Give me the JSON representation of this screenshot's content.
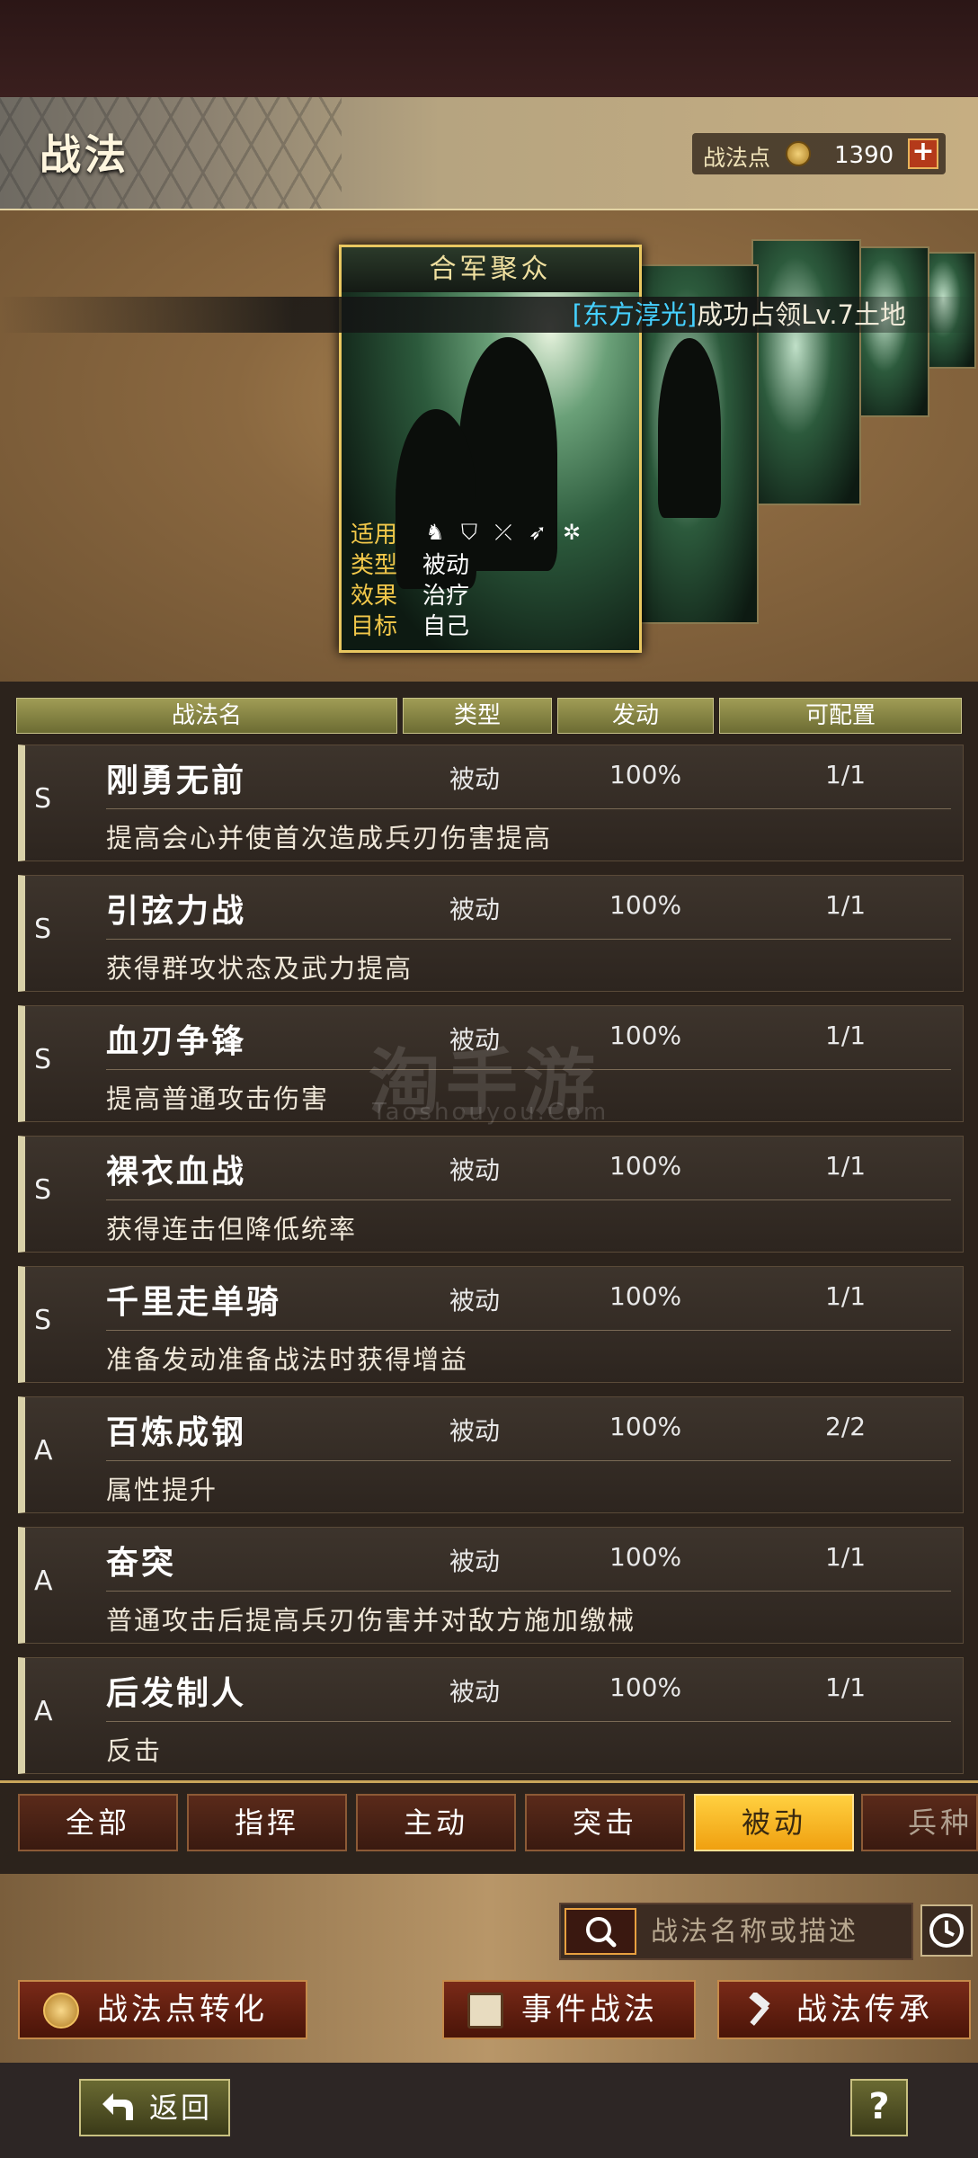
{
  "header": {
    "title": "战法",
    "points_label": "战法点",
    "points_value": "1390",
    "plus": "+"
  },
  "showcase": {
    "card": {
      "title": "合军聚众",
      "info": [
        {
          "key": "适用",
          "value": ""
        },
        {
          "key": "类型",
          "value": "被动"
        },
        {
          "key": "效果",
          "value": "治疗"
        },
        {
          "key": "目标",
          "value": "自己"
        }
      ],
      "troop_icons": [
        "cavalry-icon",
        "shield-icon",
        "bow-icon",
        "spear-icon",
        "chariot-icon"
      ]
    },
    "banner": {
      "highlight": "[东方淳光]",
      "text": "成功占领Lv.7土地"
    }
  },
  "table": {
    "headers": [
      "战法名",
      "类型",
      "发动",
      "可配置"
    ],
    "rows": [
      {
        "rank": "S",
        "name": "刚勇无前",
        "type": "被动",
        "rate": "100%",
        "count": "1/1",
        "desc": "提高会心并使首次造成兵刃伤害提高"
      },
      {
        "rank": "S",
        "name": "引弦力战",
        "type": "被动",
        "rate": "100%",
        "count": "1/1",
        "desc": "获得群攻状态及武力提高"
      },
      {
        "rank": "S",
        "name": "血刃争锋",
        "type": "被动",
        "rate": "100%",
        "count": "1/1",
        "desc": "提高普通攻击伤害"
      },
      {
        "rank": "S",
        "name": "裸衣血战",
        "type": "被动",
        "rate": "100%",
        "count": "1/1",
        "desc": "获得连击但降低统率"
      },
      {
        "rank": "S",
        "name": "千里走单骑",
        "type": "被动",
        "rate": "100%",
        "count": "1/1",
        "desc": "准备发动准备战法时获得增益"
      },
      {
        "rank": "A",
        "name": "百炼成钢",
        "type": "被动",
        "rate": "100%",
        "count": "2/2",
        "desc": "属性提升"
      },
      {
        "rank": "A",
        "name": "奋突",
        "type": "被动",
        "rate": "100%",
        "count": "1/1",
        "desc": "普通攻击后提高兵刃伤害并对敌方施加缴械"
      },
      {
        "rank": "A",
        "name": "后发制人",
        "type": "被动",
        "rate": "100%",
        "count": "1/1",
        "desc": "反击"
      }
    ]
  },
  "tabs": [
    {
      "label": "全部",
      "active": false
    },
    {
      "label": "指挥",
      "active": false
    },
    {
      "label": "主动",
      "active": false
    },
    {
      "label": "突击",
      "active": false
    },
    {
      "label": "被动",
      "active": true
    },
    {
      "label": "兵种",
      "active": false
    }
  ],
  "search": {
    "placeholder": "战法名称或描述"
  },
  "actions": {
    "convert": "战法点转化",
    "event": "事件战法",
    "inherit": "战法传承"
  },
  "footer": {
    "back": "返回",
    "help": "?"
  },
  "watermark": {
    "main": "淘手游",
    "sub": "Taoshouyou.Com"
  }
}
